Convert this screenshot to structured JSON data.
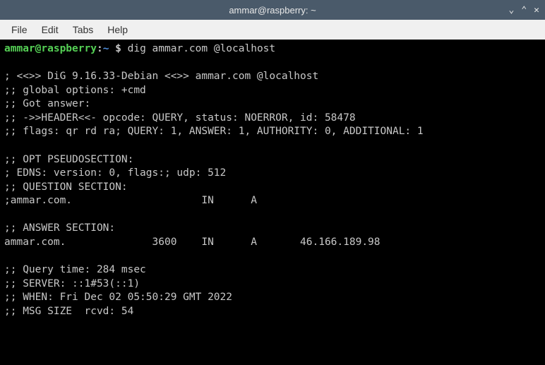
{
  "titlebar": {
    "title": "ammar@raspberry: ~"
  },
  "menubar": {
    "items": [
      "File",
      "Edit",
      "Tabs",
      "Help"
    ]
  },
  "prompt": {
    "user_host": "ammar@raspberry",
    "colon": ":",
    "path": "~",
    "dollar": " $ "
  },
  "command": "dig ammar.com @localhost",
  "output_lines": [
    "",
    "; <<>> DiG 9.16.33-Debian <<>> ammar.com @localhost",
    ";; global options: +cmd",
    ";; Got answer:",
    ";; ->>HEADER<<- opcode: QUERY, status: NOERROR, id: 58478",
    ";; flags: qr rd ra; QUERY: 1, ANSWER: 1, AUTHORITY: 0, ADDITIONAL: 1",
    "",
    ";; OPT PSEUDOSECTION:",
    "; EDNS: version: 0, flags:; udp: 512",
    ";; QUESTION SECTION:",
    ";ammar.com.                     IN      A",
    "",
    ";; ANSWER SECTION:",
    "ammar.com.              3600    IN      A       46.166.189.98",
    "",
    ";; Query time: 284 msec",
    ";; SERVER: ::1#53(::1)",
    ";; WHEN: Fri Dec 02 05:50:29 GMT 2022",
    ";; MSG SIZE  rcvd: 54"
  ]
}
